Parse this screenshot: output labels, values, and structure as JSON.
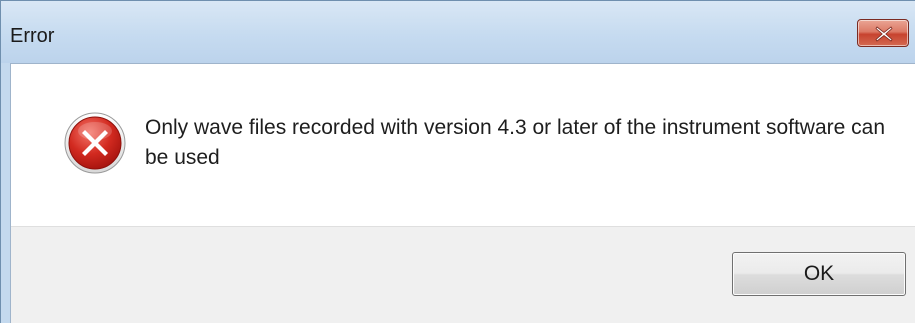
{
  "window": {
    "title": "Error",
    "close_icon": "close-icon"
  },
  "message": {
    "icon": "error-icon",
    "text": "Only wave files recorded with version 4.3 or later of the instrument software can be used"
  },
  "buttons": {
    "ok_label": "OK"
  },
  "colors": {
    "title_bar": "#c6dbf0",
    "close_button": "#c7432f",
    "error_icon": "#c8201a",
    "button_area": "#f0f0f0"
  }
}
